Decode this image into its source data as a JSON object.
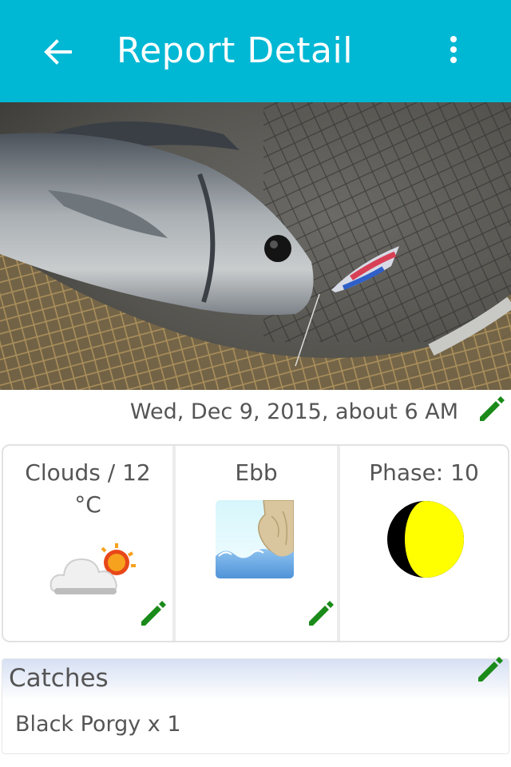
{
  "appbar": {
    "title": "Report Detail",
    "background": "#00b8d4",
    "back_icon": "arrow-left-icon",
    "menu_icon": "more-vertical-icon"
  },
  "photo": {
    "subject": "photo"
  },
  "report": {
    "date": "Wed, Dec 9, 2015, about 6 AM",
    "edit_icon": "pencil-icon",
    "edit_color": "#1a8a1a"
  },
  "conditions": {
    "weather": {
      "label": "Clouds / 12 °C",
      "icon": "cloud-sun-icon"
    },
    "tide": {
      "label": "Ebb",
      "icon": "tide-wave-icon"
    },
    "moon": {
      "label": "Phase: 10",
      "icon": "moon-phase-icon"
    }
  },
  "catches": {
    "title": "Catches",
    "items": [
      "Black Porgy x 1"
    ]
  }
}
